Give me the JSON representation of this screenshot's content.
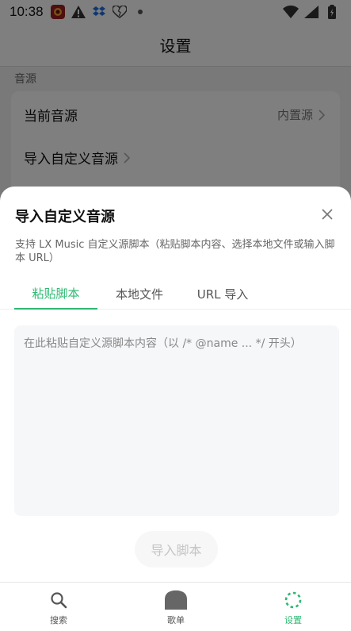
{
  "status_bar": {
    "time": "10:38",
    "icons": [
      "app-icon",
      "warning-icon",
      "dropbox-icon",
      "heart-icon",
      "dot-icon",
      "wifi-icon",
      "signal-icon",
      "battery-icon"
    ]
  },
  "app_bar": {
    "title": "设置"
  },
  "settings": {
    "section_label": "音源",
    "rows": [
      {
        "label": "当前音源",
        "value": "内置源"
      },
      {
        "label": "导入自定义音源"
      }
    ]
  },
  "sheet": {
    "title": "导入自定义音源",
    "description": "支持 LX Music 自定义源脚本（粘贴脚本内容、选择本地文件或输入脚本 URL）",
    "tabs": [
      {
        "label": "粘贴脚本",
        "active": true
      },
      {
        "label": "本地文件",
        "active": false
      },
      {
        "label": "URL 导入",
        "active": false
      }
    ],
    "textarea_placeholder": "在此粘贴自定义源脚本内容（以 /* @name ... */ 开头）",
    "textarea_value": "",
    "import_button": "导入脚本"
  },
  "bottom_nav": {
    "items": [
      {
        "label": "搜索",
        "icon": "search-icon",
        "active": false
      },
      {
        "label": "歌单",
        "icon": "home-icon",
        "active": false
      },
      {
        "label": "设置",
        "icon": "settings-icon",
        "active": true
      }
    ]
  },
  "colors": {
    "accent": "#2eb872",
    "overlay": "rgba(0,0,0,0.5)",
    "textarea_bg": "#f6f7f9"
  }
}
